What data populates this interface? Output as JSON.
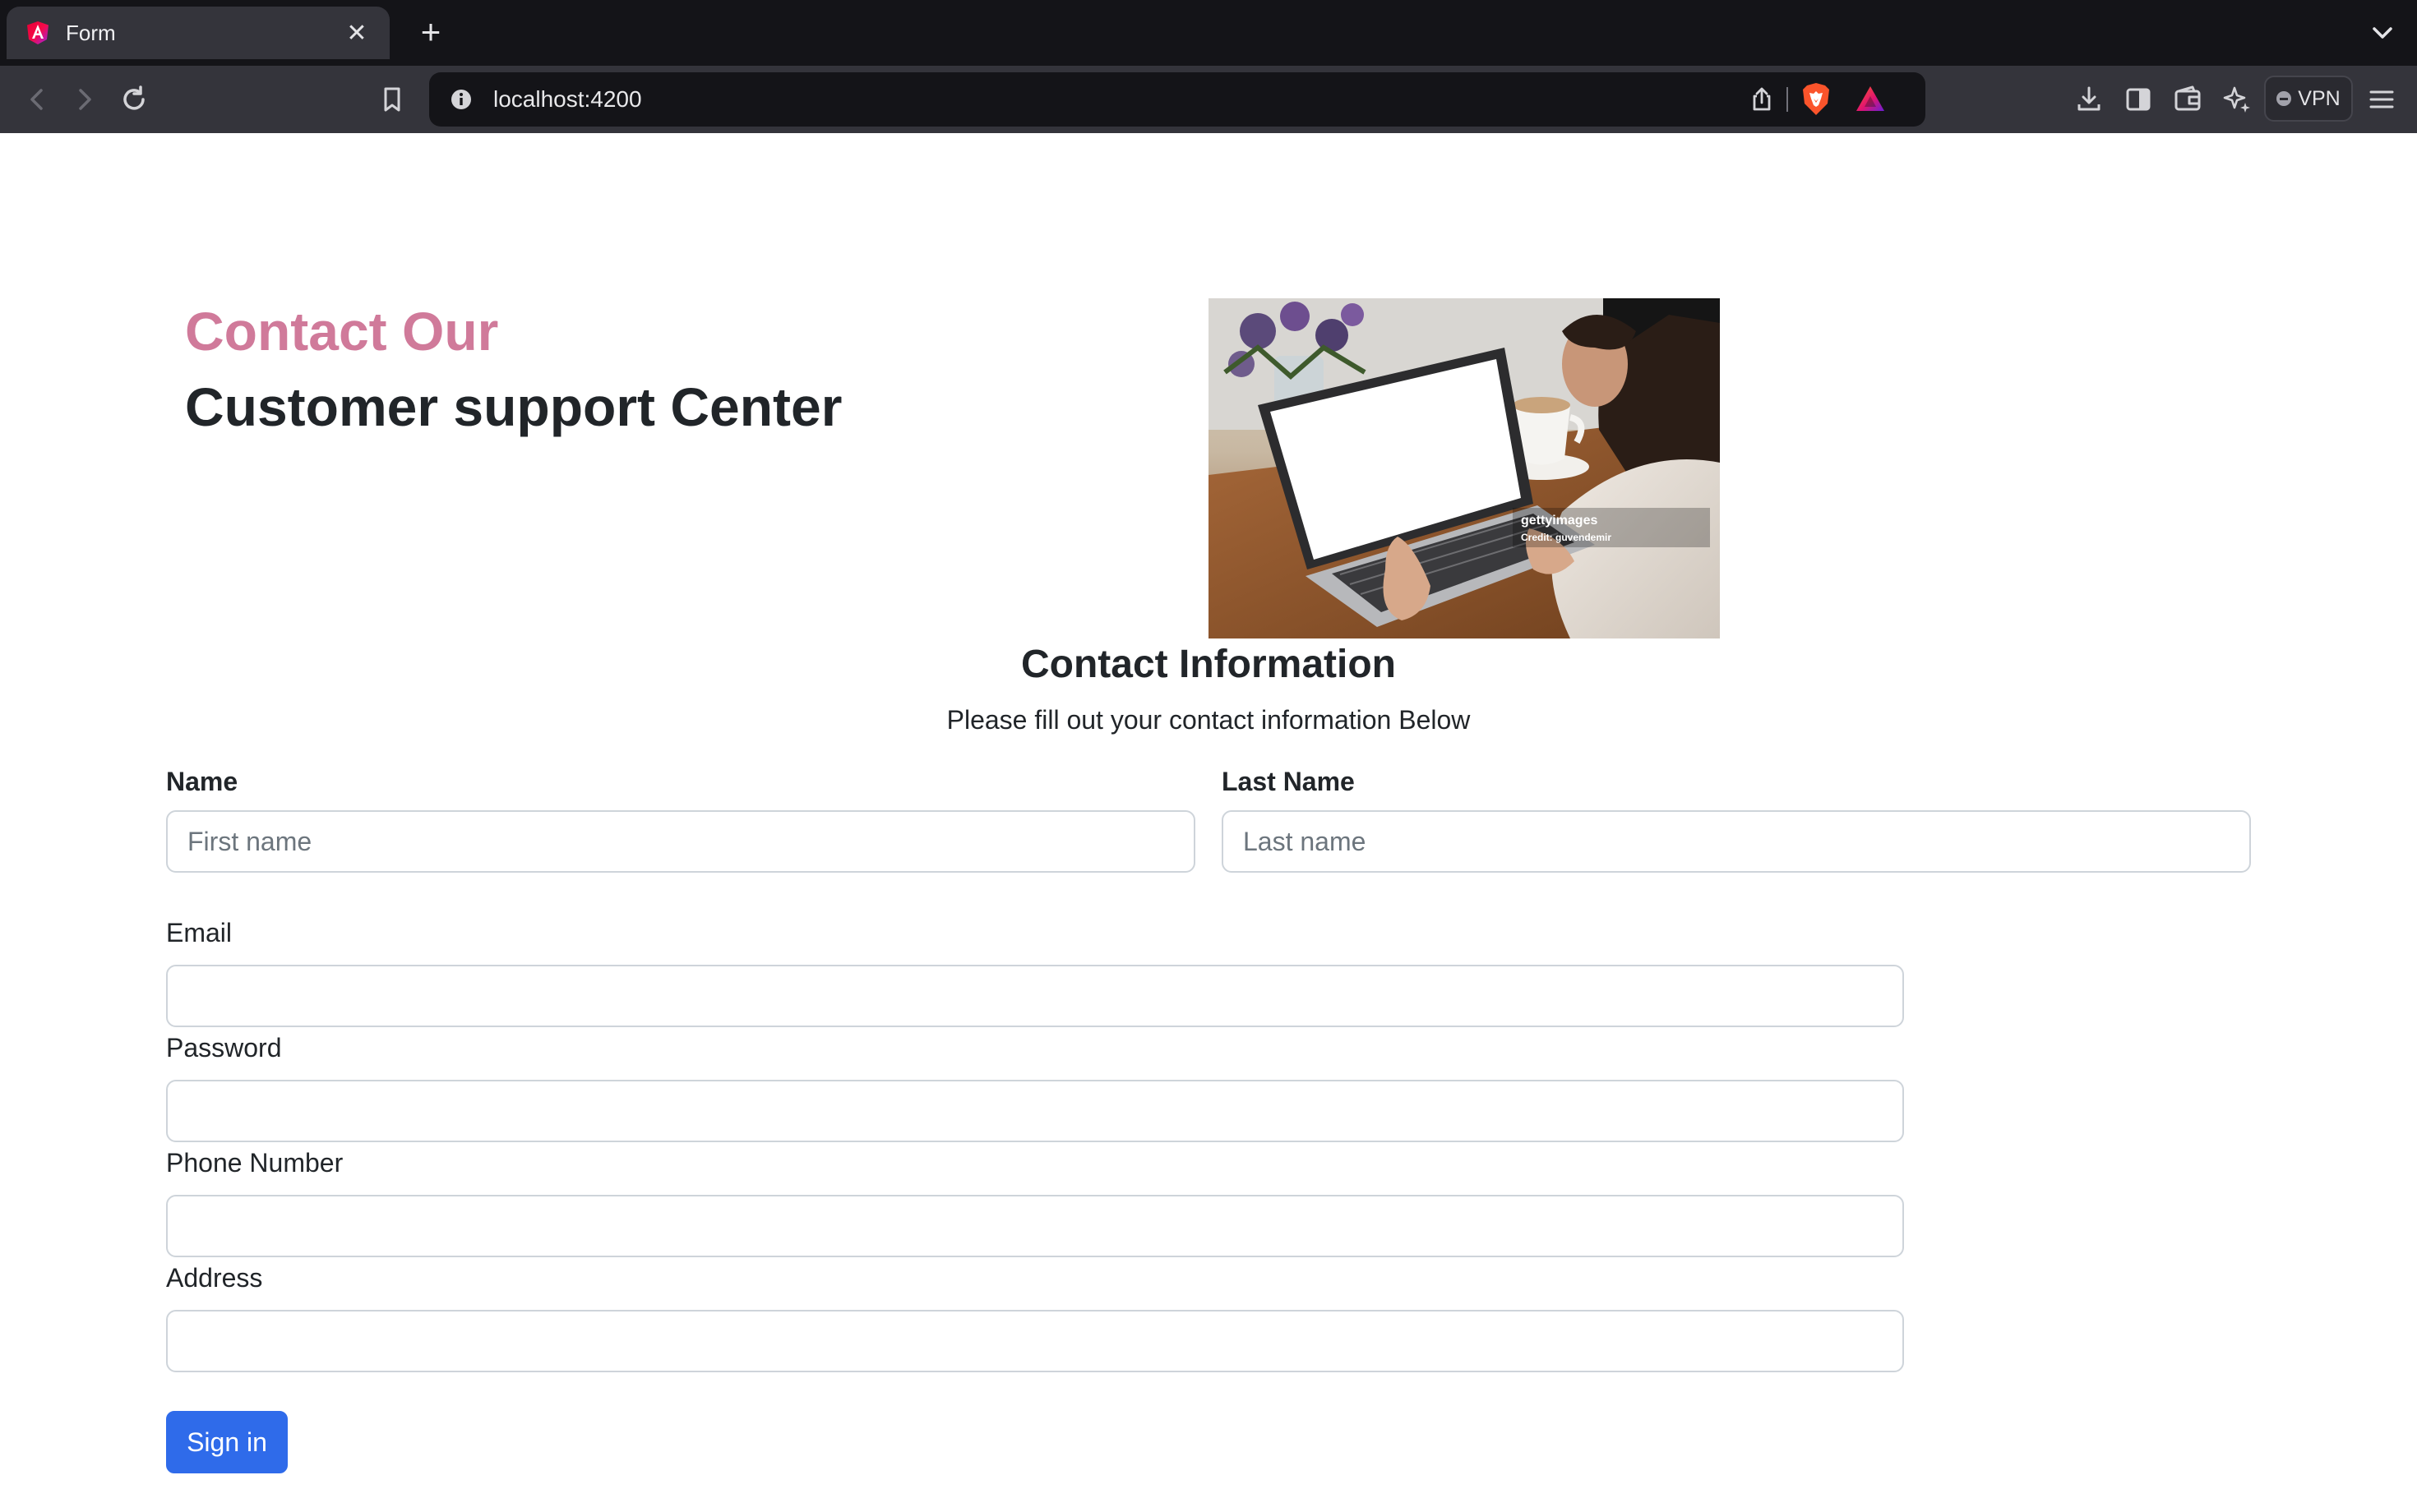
{
  "browser": {
    "tab_title": "Form",
    "address": "localhost:4200",
    "vpn_label": "VPN"
  },
  "hero": {
    "accent_line": "Contact Our",
    "title_line": "Customer support Center"
  },
  "photo": {
    "watermark_brand": "gettyimages",
    "watermark_credit": "Credit: guvendemir"
  },
  "section": {
    "title": "Contact Information",
    "subtitle": "Please fill out your contact information Below"
  },
  "form": {
    "name_label": "Name",
    "first_name_placeholder": "First name",
    "last_name_label": "Last Name",
    "last_name_placeholder": "Last name",
    "email_label": "Email",
    "password_label": "Password",
    "phone_label": "Phone Number",
    "address_label": "Address",
    "submit_label": "Sign in"
  },
  "colors": {
    "accent": "#d07a9a",
    "primary_button": "#2f6bea",
    "text": "#212529"
  }
}
